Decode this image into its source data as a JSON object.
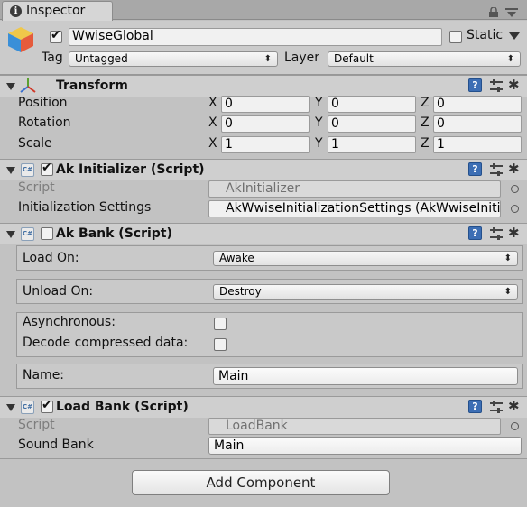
{
  "tab": {
    "title": "Inspector"
  },
  "header": {
    "object_name": "WwiseGlobal",
    "active": true,
    "static_label": "Static",
    "static_checked": false,
    "tag_label": "Tag",
    "tag_value": "Untagged",
    "layer_label": "Layer",
    "layer_value": "Default"
  },
  "transform": {
    "title": "Transform",
    "rows": [
      {
        "label": "Position",
        "x": "0",
        "y": "0",
        "z": "0"
      },
      {
        "label": "Rotation",
        "x": "0",
        "y": "0",
        "z": "0"
      },
      {
        "label": "Scale",
        "x": "1",
        "y": "1",
        "z": "1"
      }
    ],
    "axis": {
      "x": "X",
      "y": "Y",
      "z": "Z"
    }
  },
  "ak_initializer": {
    "title": "Ak Initializer (Script)",
    "enabled": true,
    "script_label": "Script",
    "script_value": "AkInitializer",
    "settings_label": "Initialization Settings",
    "settings_value": "AkWwiseInitializationSettings (AkWwiseIniti"
  },
  "ak_bank": {
    "title": "Ak Bank (Script)",
    "enabled": false,
    "load_on_label": "Load On:",
    "load_on_value": "Awake",
    "unload_on_label": "Unload On:",
    "unload_on_value": "Destroy",
    "async_label": "Asynchronous:",
    "async_checked": false,
    "decode_label": "Decode compressed data:",
    "decode_checked": false,
    "name_label": "Name:",
    "name_value": "Main"
  },
  "load_bank": {
    "title": "Load Bank (Script)",
    "enabled": true,
    "script_label": "Script",
    "script_value": "LoadBank",
    "sound_bank_label": "Sound Bank",
    "sound_bank_value": "Main"
  },
  "footer": {
    "add_component_label": "Add Component"
  },
  "icons": {
    "help": "?",
    "info": "i",
    "gear": "✱"
  }
}
